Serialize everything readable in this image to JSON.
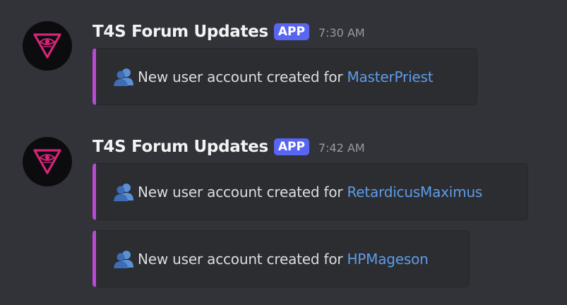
{
  "messages": [
    {
      "author": "T4S Forum Updates",
      "badge": "APP",
      "time": "7:30 AM",
      "embeds": [
        {
          "icon": "users-icon",
          "text": "New user account created for",
          "link": "MasterPriest"
        }
      ]
    },
    {
      "author": "T4S Forum Updates",
      "badge": "APP",
      "time": "7:42 AM",
      "embeds": [
        {
          "icon": "users-icon",
          "text": "New user account created for",
          "link": "RetardicusMaximus"
        },
        {
          "icon": "users-icon",
          "text": "New user account created for",
          "link": "HPMageson"
        }
      ]
    }
  ],
  "colors": {
    "background": "#313338",
    "embed_bg": "#2b2d31",
    "embed_accent": "#b84ad3",
    "badge": "#5865f2",
    "link": "#5e9ce9",
    "avatar_logo": "#d8247a"
  }
}
